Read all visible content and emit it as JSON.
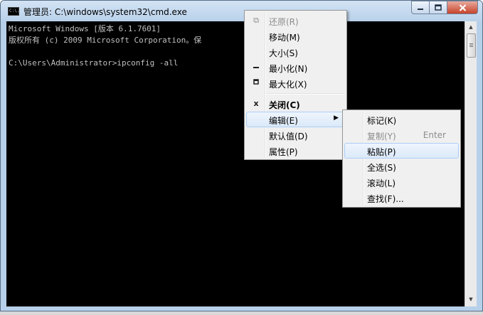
{
  "window": {
    "title": "管理员: C:\\windows\\system32\\cmd.exe",
    "icon_text": "C:\\.",
    "buttons": {
      "minimize_icon": "minimize-icon",
      "maximize_icon": "maximize-icon",
      "close_icon": "close-icon"
    }
  },
  "console": {
    "lines": [
      "Microsoft Windows [版本 6.1.7601]",
      "版权所有 (c) 2009 Microsoft Corporation。保",
      "",
      "C:\\Users\\Administrator>ipconfig -all"
    ],
    "text_color": "#c0c0c0",
    "background": "#000000"
  },
  "system_menu": {
    "items": [
      {
        "label": "还原(R)",
        "icon": "restore-icon",
        "enabled": false
      },
      {
        "label": "移动(M)",
        "icon": "",
        "enabled": true
      },
      {
        "label": "大小(S)",
        "icon": "",
        "enabled": true
      },
      {
        "label": "最小化(N)",
        "icon": "minimize-icon",
        "enabled": true
      },
      {
        "label": "最大化(X)",
        "icon": "maximize-icon",
        "enabled": true
      },
      {
        "label": "关闭(C)",
        "icon": "close-icon",
        "enabled": true,
        "bold": true
      },
      {
        "label": "编辑(E)",
        "icon": "",
        "enabled": true,
        "submenu": true,
        "highlighted": true
      },
      {
        "label": "默认值(D)",
        "icon": "",
        "enabled": true
      },
      {
        "label": "属性(P)",
        "icon": "",
        "enabled": true
      }
    ]
  },
  "edit_submenu": {
    "items": [
      {
        "label": "标记(K)",
        "enabled": true
      },
      {
        "label": "复制(Y)",
        "shortcut": "Enter",
        "enabled": false
      },
      {
        "label": "粘贴(P)",
        "enabled": true,
        "highlighted": true
      },
      {
        "label": "全选(S)",
        "enabled": true
      },
      {
        "label": "滚动(L)",
        "enabled": true
      },
      {
        "label": "查找(F)...",
        "enabled": true
      }
    ]
  },
  "colors": {
    "titlebar": "#b9d1ea",
    "close_button": "#c7432b",
    "highlight": "#dbe9f8"
  }
}
